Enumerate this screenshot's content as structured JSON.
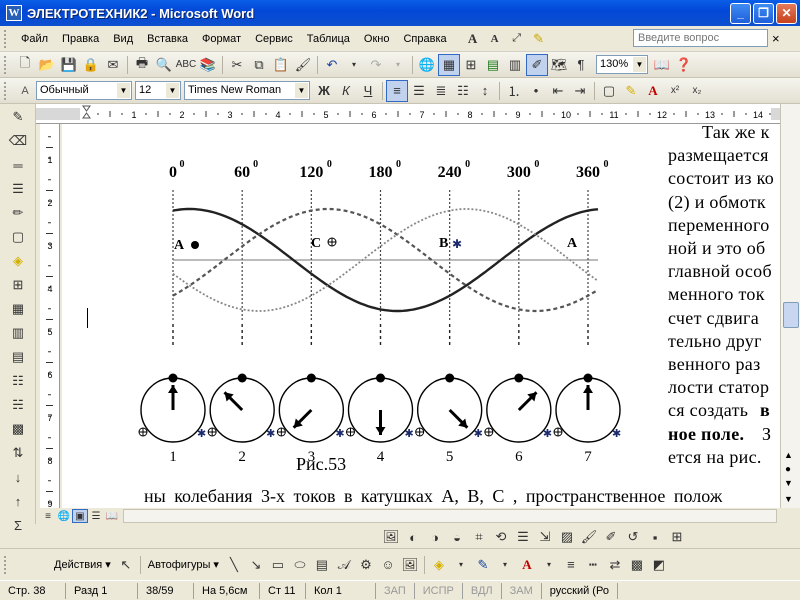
{
  "window": {
    "title": "ЭЛЕКТРОТЕХНИК2 - Microsoft Word",
    "app_icon": "W"
  },
  "menu": {
    "items": [
      "Файл",
      "Правка",
      "Вид",
      "Вставка",
      "Формат",
      "Сервис",
      "Таблица",
      "Окно",
      "Справка"
    ],
    "ask_placeholder": "Введите вопрос",
    "close_doc": "×"
  },
  "toolbar": {
    "zoom": "130%"
  },
  "format": {
    "style": "Обычный",
    "size": "12",
    "font": "Times New Roman",
    "bold": "Ж",
    "italic": "К",
    "underline": "Ч"
  },
  "figure": {
    "angles": [
      "0",
      "60",
      "120",
      "180",
      "240",
      "300",
      "360"
    ],
    "degree_mark": "0",
    "labels": {
      "a1": "A",
      "c": "C",
      "b": "B",
      "a2": "A"
    },
    "numbers": [
      "1",
      "2",
      "3",
      "4",
      "5",
      "6",
      "7"
    ],
    "caption": "Рис.53",
    "needle_angles_deg": [
      0,
      -45,
      -135,
      180,
      135,
      45,
      0
    ]
  },
  "doc_text": {
    "lines": [
      {
        "text": "Так же к",
        "bold": false
      },
      {
        "text": "размещается",
        "bold": false
      },
      {
        "text": "состоит из ко",
        "bold": false
      },
      {
        "text": "(2) и обмотк",
        "bold": false
      },
      {
        "text": "переменного",
        "bold": false
      },
      {
        "text": "ной и это об",
        "bold": false
      },
      {
        "text": "главной особ",
        "bold": false
      },
      {
        "text": "менного ток",
        "bold": false
      },
      {
        "text": "счет сдвига",
        "bold": false
      },
      {
        "text": "тельно друг",
        "bold": false
      },
      {
        "text": "венного раз",
        "bold": false
      },
      {
        "text": "лости статор",
        "bold": false
      },
      {
        "text": "ся создать",
        "bold": false
      },
      {
        "text": "ное поле.",
        "bold": true
      },
      {
        "text": "ется на рис.",
        "bold": false
      }
    ],
    "bottom_line": "ны колебания 3-х токов в катушках А, В, С , пространственное полож",
    "extra_13": "в",
    "extra_14": "З"
  },
  "ruler": {
    "h_numbers": [
      "1",
      "2",
      "3",
      "4",
      "5",
      "6",
      "7",
      "8",
      "9",
      "10",
      "11",
      "12",
      "13",
      "14"
    ],
    "v_numbers": [
      "1",
      "2",
      "3",
      "4",
      "5",
      "6",
      "7",
      "8",
      "9"
    ]
  },
  "drawing": {
    "actions": "Действия",
    "autoshapes": "Автофигуры"
  },
  "status": {
    "page": "Стр. 38",
    "section": "Разд 1",
    "pages": "38/59",
    "at": "На 5,6см",
    "line": "Ст 11",
    "col": "Кол 1",
    "rec": "ЗАП",
    "trk": "ИСПР",
    "ext": "ВДЛ",
    "ovr": "ЗАМ",
    "lang": "русский (Ро"
  },
  "colors": {
    "title_blue": "#0a5ee8",
    "chrome": "#ece9d8"
  }
}
